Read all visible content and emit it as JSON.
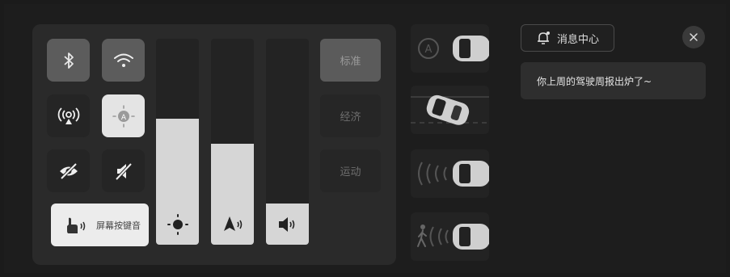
{
  "quick_toggles": {
    "bluetooth": {
      "icon": "bluetooth-icon",
      "active": true
    },
    "wifi": {
      "icon": "wifi-icon",
      "active": true
    },
    "hotspot": {
      "icon": "hotspot-icon",
      "active": false
    },
    "auto_brightness": {
      "icon": "auto-brightness-icon",
      "active": true
    },
    "privacy": {
      "icon": "eye-off-icon",
      "active": false
    },
    "mute": {
      "icon": "mute-icon",
      "active": false
    },
    "screen_key_sound": {
      "label": "屏幕按键音",
      "icon": "touch-sound-icon",
      "active": true
    }
  },
  "sliders": {
    "brightness": {
      "icon": "sun-icon",
      "level": 0.61
    },
    "navigation_volume": {
      "icon": "navigation-volume-icon",
      "level": 0.49
    },
    "media_volume": {
      "icon": "speaker-icon",
      "level": 0.2
    }
  },
  "drive_modes": [
    {
      "label": "标准",
      "selected": true
    },
    {
      "label": "经济",
      "selected": false
    },
    {
      "label": "运动",
      "selected": false
    }
  ],
  "assist_cards": [
    "auto-hold-car-icon",
    "lane-car-icon",
    "radar-car-icon",
    "pedestrian-car-icon"
  ],
  "notifications": {
    "center_label": "消息中心",
    "message": "你上周的驾驶周报出炉了~"
  },
  "colors": {
    "background": "#1d1d1d",
    "panel": "#2a2a2a",
    "active_tile": "#5c5c5c",
    "light_tile": "#e4e4e4"
  }
}
